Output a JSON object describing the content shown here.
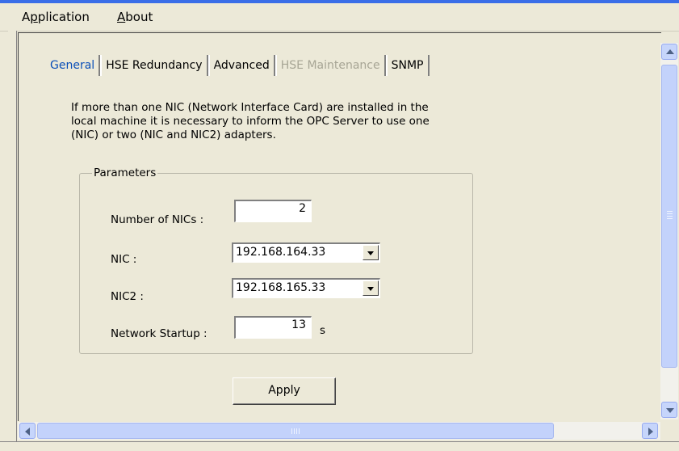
{
  "menu": {
    "application": {
      "pre": "A",
      "underline": "p",
      "post": "plication"
    },
    "about": {
      "pre": "",
      "underline": "A",
      "post": "bout"
    }
  },
  "tabs": [
    {
      "label": "General",
      "state": "active"
    },
    {
      "label": "HSE Redundancy",
      "state": "normal"
    },
    {
      "label": "Advanced",
      "state": "normal"
    },
    {
      "label": "HSE Maintenance",
      "state": "disabled"
    },
    {
      "label": "SNMP",
      "state": "normal"
    }
  ],
  "description": {
    "line1": "If more than one NIC (Network Interface Card) are installed in the",
    "line2": "local machine it is necessary to inform the OPC Server to use one",
    "line3": "(NIC) or two (NIC and NIC2) adapters."
  },
  "parameters": {
    "legend": "Parameters",
    "num_nics_label": "Number of NICs :",
    "num_nics_value": "2",
    "nic_label": "NIC :",
    "nic_value": "192.168.164.33",
    "nic2_label": "NIC2 :",
    "nic2_value": "192.168.165.33",
    "startup_label": "Network Startup :",
    "startup_value": "13",
    "startup_unit": "s"
  },
  "apply_label": "Apply",
  "colors": {
    "active_tab": "#0a4fb8",
    "disabled_tab": "#a7a595",
    "titlebar": "#3a6ee8"
  }
}
